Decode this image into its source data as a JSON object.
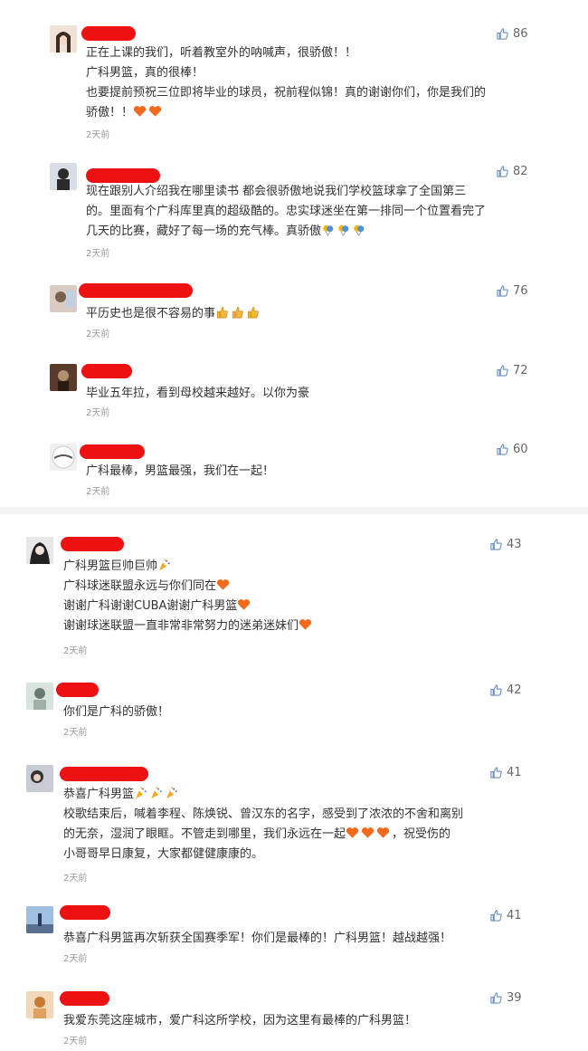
{
  "comments_1": [
    {
      "lines": [
        "正在上课的我们，听着教室外的呐喊声，很骄傲！！",
        "广科男篮，真的很棒！",
        "也要提前预祝三位即将毕业的球员，祝前程似锦！真的谢谢你们，你是我们的",
        "骄傲！！"
      ],
      "time": "2天前",
      "likes": "86",
      "avatar_colors": [
        "#efe3d8",
        "#3a2a22"
      ]
    },
    {
      "lines": [
        "现在跟别人介绍我在哪里读书 都会很骄傲地说我们学校篮球拿了全国第三",
        "的。里面有个广科库里真的超级酷的。忠实球迷坐在第一排同一个位置看完了",
        "几天的比赛，藏好了每一场的充气棒。真骄傲"
      ],
      "time": "2天前",
      "likes": "82",
      "avatar_colors": [
        "#d9dde6",
        "#2b2b2b"
      ]
    },
    {
      "lines": [
        "平历史也是很不容易的事"
      ],
      "time": "2天前",
      "likes": "76",
      "avatar_colors": [
        "#d8ccc4",
        "#7a6050"
      ]
    },
    {
      "lines": [
        "毕业五年拉，看到母校越来越好。以你为豪"
      ],
      "time": "2天前",
      "likes": "72",
      "avatar_colors": [
        "#5a3a2a",
        "#b09070"
      ]
    },
    {
      "lines": [
        "广科最棒，男篮最强，我们在一起！"
      ],
      "time": "2天前",
      "likes": "60",
      "avatar_colors": [
        "#f0f0f0",
        "#555555"
      ]
    }
  ],
  "comments_2": [
    {
      "lines": [
        "广科男篮巨帅巨帅",
        "广科球迷联盟永远与你们同在",
        "谢谢广科谢谢CUBA谢谢广科男篮",
        "谢谢球迷联盟一直非常非常努力的迷弟迷妹们"
      ],
      "time": "2天前",
      "likes": "43",
      "avatar_colors": [
        "#e8e8e8",
        "#222222"
      ]
    },
    {
      "lines": [
        "你们是广科的骄傲！"
      ],
      "time": "2天前",
      "likes": "42",
      "avatar_colors": [
        "#d7e3dc",
        "#6a7a70"
      ]
    },
    {
      "lines": [
        "恭喜广科男篮",
        "校歌结束后，喊着李程、陈焕锐、曾汉东的名字，感受到了浓浓的不舍和离别",
        "的无奈，湿润了眼眶。不管走到哪里，我们永远在一起",
        "小哥哥早日康复，大家都健健康康的。"
      ],
      "time": "2天前",
      "likes": "41",
      "avatar_colors": [
        "#c8ccd4",
        "#333333"
      ]
    },
    {
      "lines": [
        "恭喜广科男篮再次斩获全国赛季军！你们是最棒的！广科男篮！越战越强！"
      ],
      "time": "2天前",
      "likes": "41",
      "avatar_colors": [
        "#9fc0e0",
        "#2a3a5a"
      ]
    },
    {
      "lines": [
        "我爱东莞这座城市，爱广科这所学校，因为这里有最棒的广科男篮！"
      ],
      "time": "2天前",
      "likes": "39",
      "avatar_colors": [
        "#f2d8b8",
        "#c87a30"
      ]
    }
  ],
  "extras": {
    "c1_tail": "，你是我们的",
    "c3_tail": "，祝受伤的",
    "c2_heart_suffix": "谢谢广科谢谢CUBA谢谢广科男篮"
  }
}
